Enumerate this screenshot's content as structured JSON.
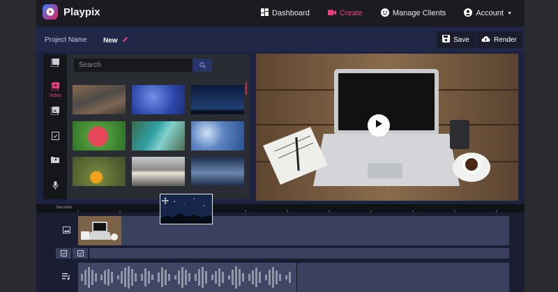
{
  "app": {
    "name": "Playpix"
  },
  "nav": {
    "items": [
      {
        "label": "Dashboard",
        "icon": "dashboard-icon"
      },
      {
        "label": "Create",
        "icon": "video-camera-icon",
        "active": true
      },
      {
        "label": "Manage Clients",
        "icon": "smiley-icon"
      },
      {
        "label": "Account",
        "icon": "user-circle-icon"
      }
    ]
  },
  "project": {
    "label": "Project Name",
    "name": "New"
  },
  "toolbar": {
    "save_label": "Save",
    "render_label": "Render"
  },
  "sidebar": {
    "items": [
      {
        "label": "",
        "icon": "images-icon"
      },
      {
        "label": "Video",
        "icon": "video-library-icon",
        "active": true
      },
      {
        "label": "",
        "icon": "photo-library-icon"
      },
      {
        "label": "",
        "icon": "add-note-icon"
      },
      {
        "label": "",
        "icon": "user-folder-icon"
      },
      {
        "label": "",
        "icon": "microphone-icon"
      }
    ]
  },
  "media": {
    "search_placeholder": "Search",
    "thumbnails": [
      {
        "name": "water-waves"
      },
      {
        "name": "blue-crystals"
      },
      {
        "name": "night-sky"
      },
      {
        "name": "red-rose"
      },
      {
        "name": "aerial-coast"
      },
      {
        "name": "ice-pattern"
      },
      {
        "name": "yellow-flower"
      },
      {
        "name": "sunset-beach"
      },
      {
        "name": "moonlit-sea"
      }
    ]
  },
  "timeline": {
    "ruler_label": "Seconds"
  },
  "colors": {
    "accent": "#ea3f7a",
    "panel": "#2a2c33",
    "nav": "#1b1c21",
    "frame": "#1c2240"
  }
}
